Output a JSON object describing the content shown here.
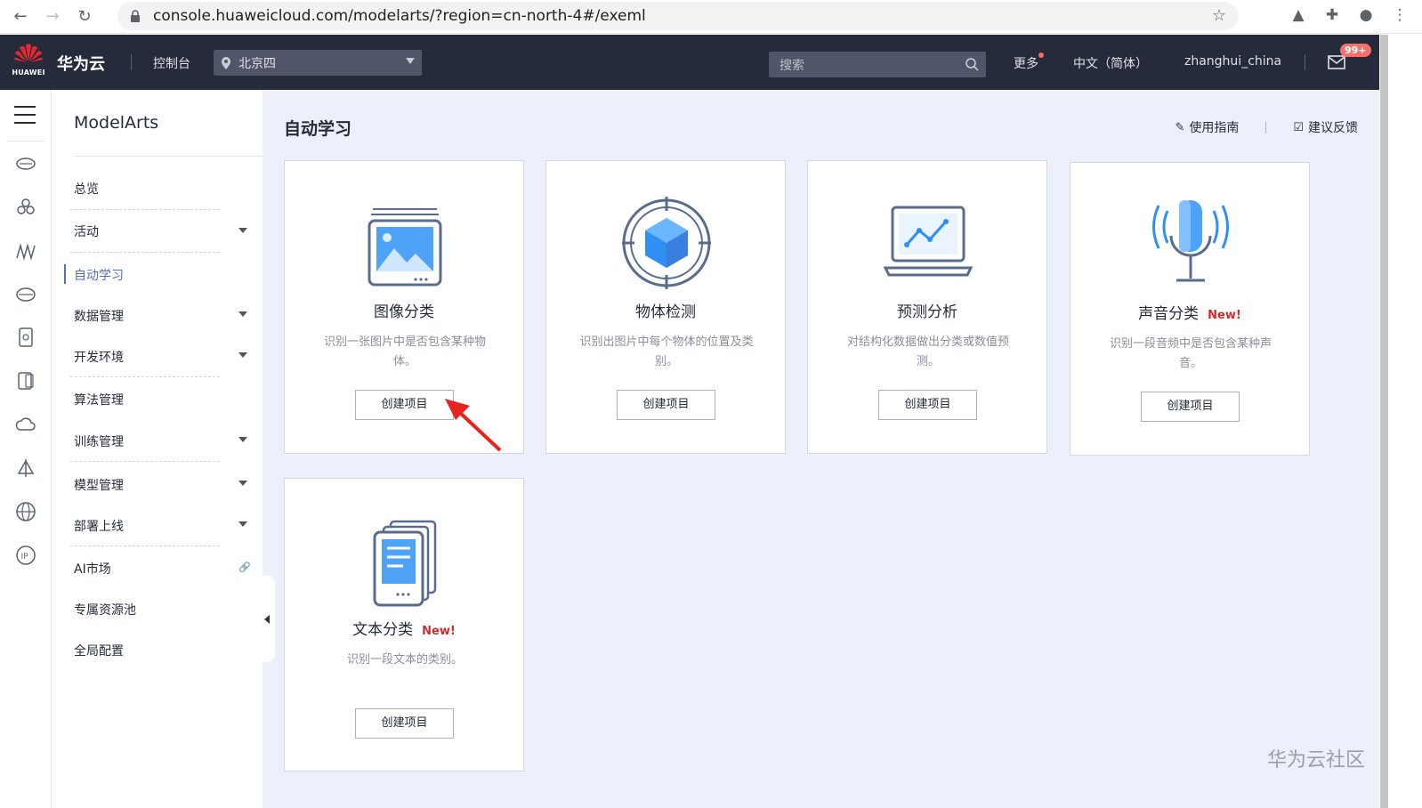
{
  "browser": {
    "url": "console.huaweicloud.com/modelarts/?region=cn-north-4#/exeml"
  },
  "header": {
    "brand_logo_text": "HUAWEI",
    "brand_name": "华为云",
    "console_label": "控制台",
    "region": "北京四",
    "search_placeholder": "搜索",
    "more_label": "更多",
    "language": "中文（简体）",
    "username": "zhanghui_china",
    "mail_badge": "99+"
  },
  "sidebar": {
    "service_title": "ModelArts",
    "items": [
      {
        "label": "总览",
        "has_submenu": false
      },
      {
        "label": "活动",
        "has_submenu": true
      },
      {
        "label": "自动学习",
        "has_submenu": false,
        "active": true
      },
      {
        "label": "数据管理",
        "has_submenu": true
      },
      {
        "label": "开发环境",
        "has_submenu": true
      },
      {
        "label": "算法管理",
        "has_submenu": false
      },
      {
        "label": "训练管理",
        "has_submenu": true
      },
      {
        "label": "模型管理",
        "has_submenu": true
      },
      {
        "label": "部署上线",
        "has_submenu": true
      },
      {
        "label": "AI市场",
        "has_submenu": false,
        "external_link": true
      },
      {
        "label": "专属资源池",
        "has_submenu": false
      },
      {
        "label": "全局配置",
        "has_submenu": false
      }
    ]
  },
  "main": {
    "page_title": "自动学习",
    "guide_link": "使用指南",
    "feedback_link": "建议反馈",
    "cards": [
      {
        "name": "图像分类",
        "desc": "识别一张图片中是否包含某种物体。",
        "button": "创建项目",
        "is_new": false,
        "icon": "image-classification-icon"
      },
      {
        "name": "物体检测",
        "desc": "识别出图片中每个物体的位置及类别。",
        "button": "创建项目",
        "is_new": false,
        "icon": "object-detection-icon"
      },
      {
        "name": "预测分析",
        "desc": "对结构化数据做出分类或数值预测。",
        "button": "创建项目",
        "is_new": false,
        "icon": "predictive-analysis-icon"
      },
      {
        "name": "声音分类",
        "desc": "识别一段音频中是否包含某种声音。",
        "button": "创建项目",
        "is_new": true,
        "new_label": "New!",
        "icon": "sound-classification-icon"
      },
      {
        "name": "文本分类",
        "desc": "识别一段文本的类别。",
        "button": "创建项目",
        "is_new": true,
        "new_label": "New!",
        "icon": "text-classification-icon"
      }
    ]
  },
  "watermark": "华为云社区",
  "colors": {
    "header_bg": "#252b3a",
    "accent": "#526ecc",
    "content_bg": "#edf0fa",
    "new_tag": "#d12c2c",
    "annotation_arrow": "#e8231d"
  }
}
